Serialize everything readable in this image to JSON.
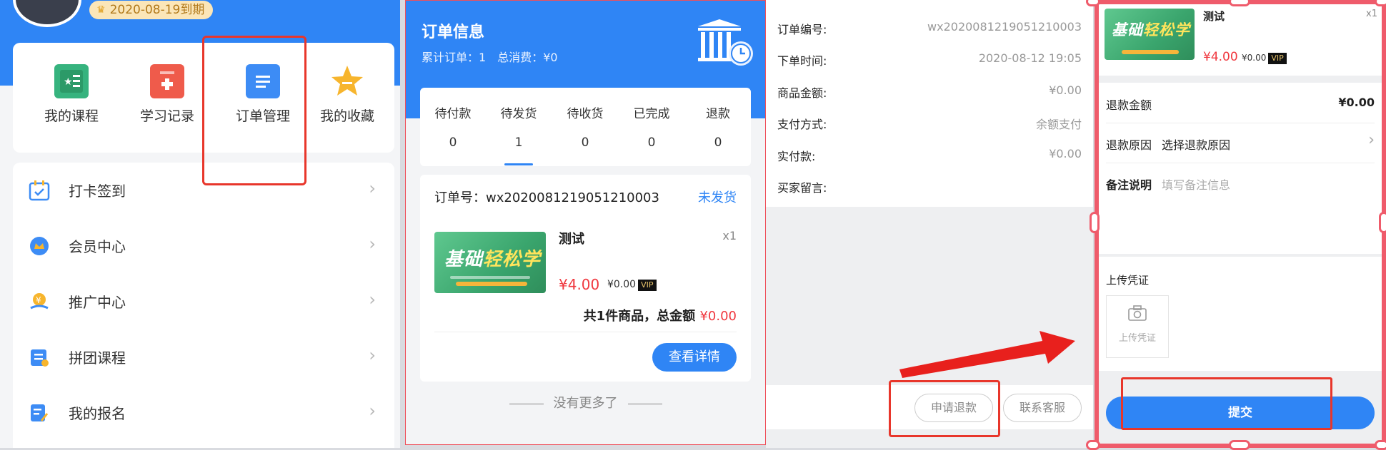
{
  "profile": {
    "expire_text": "2020-08-19到期"
  },
  "quick_actions": [
    {
      "label": "我的课程",
      "icon": "book-icon",
      "color": "#36b37e"
    },
    {
      "label": "学习记录",
      "icon": "record-icon",
      "color": "#ef5b4b"
    },
    {
      "label": "订单管理",
      "icon": "document-icon",
      "color": "#3d8cf5"
    },
    {
      "label": "我的收藏",
      "icon": "star-icon",
      "color": "#f7b52d"
    }
  ],
  "menu": [
    {
      "label": "打卡签到",
      "icon": "calendar-icon"
    },
    {
      "label": "会员中心",
      "icon": "crown-icon"
    },
    {
      "label": "推广中心",
      "icon": "promotion-icon"
    },
    {
      "label": "拼团课程",
      "icon": "group-course-icon"
    },
    {
      "label": "我的报名",
      "icon": "signup-icon"
    }
  ],
  "order_list": {
    "title": "订单信息",
    "total_orders_label": "累计订单：1",
    "total_spent_label": "总消费：¥0",
    "tabs": [
      {
        "label": "待付款",
        "count": "0"
      },
      {
        "label": "待发货",
        "count": "1"
      },
      {
        "label": "待收货",
        "count": "0"
      },
      {
        "label": "已完成",
        "count": "0"
      },
      {
        "label": "退款",
        "count": "0"
      }
    ],
    "order": {
      "order_no": "订单号：wx2020081219051210003",
      "status": "未发货",
      "product_name": "测试",
      "qty": "x1",
      "price": "¥4.00",
      "original_price": "¥0.00",
      "vip": "VIP",
      "total_prefix": "共1件商品，总金额",
      "total_amount": "¥0.00",
      "detail_button": "查看详情"
    },
    "no_more": "没有更多了"
  },
  "thumbnail": {
    "title_a": "基础",
    "title_b": "轻松学"
  },
  "order_detail": {
    "rows": [
      {
        "key": "订单编号:",
        "value": "wx2020081219051210003"
      },
      {
        "key": "下单时间:",
        "value": "2020-08-12 19:05"
      },
      {
        "key": "商品金额:",
        "value": "¥0.00"
      },
      {
        "key": "支付方式:",
        "value": "余额支付"
      },
      {
        "key": "实付款:",
        "value": "¥0.00"
      },
      {
        "key": "买家留言:",
        "value": ""
      }
    ],
    "refund_button": "申请退款",
    "contact_button": "联系客服"
  },
  "refund": {
    "product_name": "测试",
    "qty": "x1",
    "price": "¥4.00",
    "original_price": "¥0.00",
    "vip": "VIP",
    "amount_label": "退款金额",
    "amount_value": "¥0.00",
    "reason_label": "退款原因",
    "reason_placeholder": "选择退款原因",
    "note_label": "备注说明",
    "note_placeholder": "填写备注信息",
    "upload_title": "上传凭证",
    "upload_box_label": "上传凭证",
    "submit_label": "提交"
  }
}
